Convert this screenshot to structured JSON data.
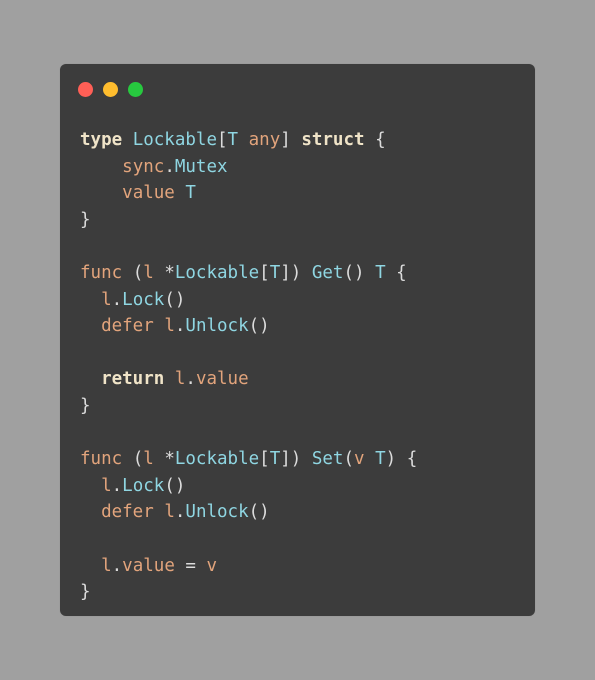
{
  "colors": {
    "background": "#a0a0a0",
    "window": "#3c3c3c",
    "close": "#ff5f56",
    "minimize": "#ffbd2e",
    "zoom": "#27c93f",
    "kw": "#f0e4c8",
    "orange": "#e2a47c",
    "cyan": "#8fd6e2",
    "plain": "#dcdcdc"
  },
  "window_controls": [
    "close-button",
    "minimize-button",
    "zoom-button"
  ],
  "code_lines": [
    [
      {
        "t": "type",
        "c": "kw",
        "b": true
      },
      {
        "t": " ",
        "c": "plain"
      },
      {
        "t": "Lockable",
        "c": "cyan"
      },
      {
        "t": "[",
        "c": "plain"
      },
      {
        "t": "T",
        "c": "cyan"
      },
      {
        "t": " ",
        "c": "plain"
      },
      {
        "t": "any",
        "c": "orange"
      },
      {
        "t": "] ",
        "c": "plain"
      },
      {
        "t": "struct",
        "c": "kw",
        "b": true
      },
      {
        "t": " {",
        "c": "plain"
      }
    ],
    [
      {
        "t": "    ",
        "c": "plain"
      },
      {
        "t": "sync",
        "c": "orange"
      },
      {
        "t": ".",
        "c": "plain"
      },
      {
        "t": "Mutex",
        "c": "cyan"
      }
    ],
    [
      {
        "t": "    ",
        "c": "plain"
      },
      {
        "t": "value",
        "c": "orange"
      },
      {
        "t": " ",
        "c": "plain"
      },
      {
        "t": "T",
        "c": "cyan"
      }
    ],
    [
      {
        "t": "}",
        "c": "plain"
      }
    ],
    [],
    [
      {
        "t": "func",
        "c": "orange"
      },
      {
        "t": " (",
        "c": "plain"
      },
      {
        "t": "l",
        "c": "orange"
      },
      {
        "t": " *",
        "c": "plain"
      },
      {
        "t": "Lockable",
        "c": "cyan"
      },
      {
        "t": "[",
        "c": "plain"
      },
      {
        "t": "T",
        "c": "cyan"
      },
      {
        "t": "]) ",
        "c": "plain"
      },
      {
        "t": "Get",
        "c": "cyan"
      },
      {
        "t": "() ",
        "c": "plain"
      },
      {
        "t": "T",
        "c": "cyan"
      },
      {
        "t": " {",
        "c": "plain"
      }
    ],
    [
      {
        "t": "  ",
        "c": "plain"
      },
      {
        "t": "l",
        "c": "orange"
      },
      {
        "t": ".",
        "c": "plain"
      },
      {
        "t": "Lock",
        "c": "cyan"
      },
      {
        "t": "()",
        "c": "plain"
      }
    ],
    [
      {
        "t": "  ",
        "c": "plain"
      },
      {
        "t": "defer",
        "c": "orange"
      },
      {
        "t": " ",
        "c": "plain"
      },
      {
        "t": "l",
        "c": "orange"
      },
      {
        "t": ".",
        "c": "plain"
      },
      {
        "t": "Unlock",
        "c": "cyan"
      },
      {
        "t": "()",
        "c": "plain"
      }
    ],
    [],
    [
      {
        "t": "  ",
        "c": "plain"
      },
      {
        "t": "return",
        "c": "kw",
        "b": true
      },
      {
        "t": " ",
        "c": "plain"
      },
      {
        "t": "l",
        "c": "orange"
      },
      {
        "t": ".",
        "c": "plain"
      },
      {
        "t": "value",
        "c": "orange"
      }
    ],
    [
      {
        "t": "}",
        "c": "plain"
      }
    ],
    [],
    [
      {
        "t": "func",
        "c": "orange"
      },
      {
        "t": " (",
        "c": "plain"
      },
      {
        "t": "l",
        "c": "orange"
      },
      {
        "t": " *",
        "c": "plain"
      },
      {
        "t": "Lockable",
        "c": "cyan"
      },
      {
        "t": "[",
        "c": "plain"
      },
      {
        "t": "T",
        "c": "cyan"
      },
      {
        "t": "]) ",
        "c": "plain"
      },
      {
        "t": "Set",
        "c": "cyan"
      },
      {
        "t": "(",
        "c": "plain"
      },
      {
        "t": "v",
        "c": "orange"
      },
      {
        "t": " ",
        "c": "plain"
      },
      {
        "t": "T",
        "c": "cyan"
      },
      {
        "t": ") {",
        "c": "plain"
      }
    ],
    [
      {
        "t": "  ",
        "c": "plain"
      },
      {
        "t": "l",
        "c": "orange"
      },
      {
        "t": ".",
        "c": "plain"
      },
      {
        "t": "Lock",
        "c": "cyan"
      },
      {
        "t": "()",
        "c": "plain"
      }
    ],
    [
      {
        "t": "  ",
        "c": "plain"
      },
      {
        "t": "defer",
        "c": "orange"
      },
      {
        "t": " ",
        "c": "plain"
      },
      {
        "t": "l",
        "c": "orange"
      },
      {
        "t": ".",
        "c": "plain"
      },
      {
        "t": "Unlock",
        "c": "cyan"
      },
      {
        "t": "()",
        "c": "plain"
      }
    ],
    [],
    [
      {
        "t": "  ",
        "c": "plain"
      },
      {
        "t": "l",
        "c": "orange"
      },
      {
        "t": ".",
        "c": "plain"
      },
      {
        "t": "value",
        "c": "orange"
      },
      {
        "t": " = ",
        "c": "plain"
      },
      {
        "t": "v",
        "c": "orange"
      }
    ],
    [
      {
        "t": "}",
        "c": "plain"
      }
    ]
  ]
}
